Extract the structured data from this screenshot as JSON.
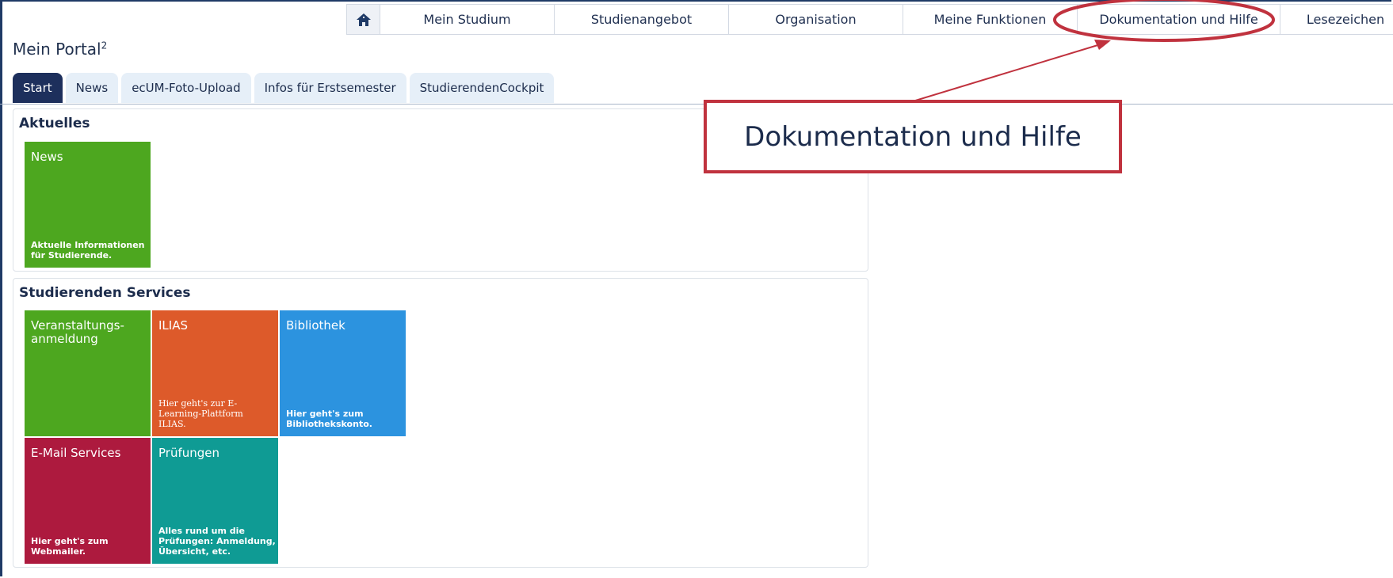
{
  "nav": {
    "items": [
      "Mein Studium",
      "Studienangebot",
      "Organisation",
      "Meine Funktionen",
      "Dokumentation und Hilfe",
      "Lesezeichen"
    ]
  },
  "portal": {
    "title": "Mein Portal",
    "sup": "2"
  },
  "tabs": [
    "Start",
    "News",
    "ecUM-Foto-Upload",
    "Infos für Erstsemester",
    "StudierendenCockpit"
  ],
  "aktuelles": {
    "heading": "Aktuelles",
    "tiles": [
      {
        "title": "News",
        "desc": "Aktuelle Informationen für Studierende.",
        "color": "#4da71f"
      }
    ]
  },
  "services": {
    "heading": "Studierenden Services",
    "tiles": [
      {
        "title": "Veranstaltungs-anmeldung",
        "desc": "",
        "color": "#4da71f"
      },
      {
        "title": "ILIAS",
        "desc": "Hier geht's zur E-Learning-Plattform ILIAS.",
        "color": "#dd5a2a"
      },
      {
        "title": "Bibliothek",
        "desc": "Hier geht's zum Bibliothekskonto.",
        "color": "#2c93df"
      },
      {
        "title": "E-Mail Services",
        "desc": "Hier geht's zum Webmailer.",
        "color": "#ad1a3e"
      },
      {
        "title": "Prüfungen",
        "desc": "Alles rund um die Prüfungen: Anmeldung, Übersicht, etc.",
        "color": "#0f9b94"
      }
    ]
  },
  "annotation": {
    "label": "Dokumentation und Hilfe",
    "color": "#c0323e"
  }
}
